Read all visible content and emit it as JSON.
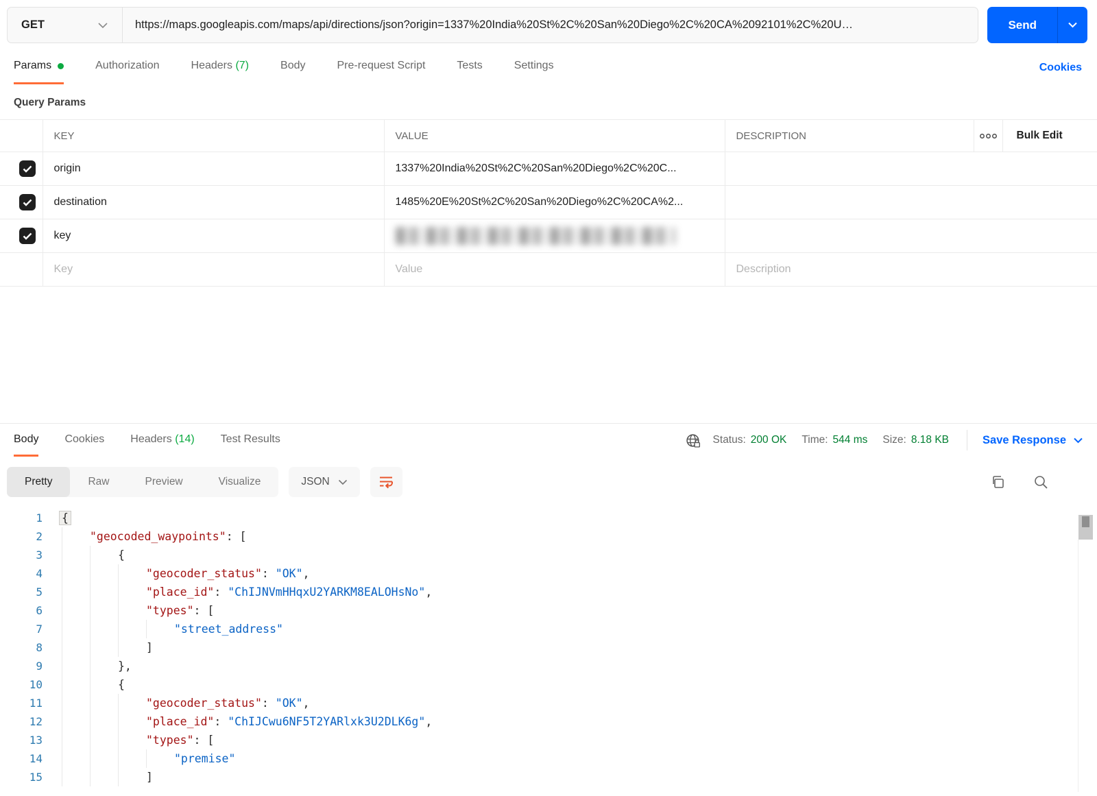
{
  "request": {
    "method": "GET",
    "url": "https://maps.googleapis.com/maps/api/directions/json?origin=1337%20India%20St%2C%20San%20Diego%2C%20CA%2092101%2C%20U…",
    "send_label": "Send",
    "tabs": {
      "params": {
        "label": "Params"
      },
      "authorization": {
        "label": "Authorization"
      },
      "headers": {
        "label": "Headers",
        "count": "(7)"
      },
      "body": {
        "label": "Body"
      },
      "prerequest": {
        "label": "Pre-request Script"
      },
      "tests": {
        "label": "Tests"
      },
      "settings": {
        "label": "Settings"
      }
    },
    "cookies_link": "Cookies",
    "section_title": "Query Params",
    "table": {
      "col_key": "KEY",
      "col_value": "VALUE",
      "col_description": "DESCRIPTION",
      "bulk_edit": "Bulk Edit",
      "rows": [
        {
          "key": "origin",
          "value": "1337%20India%20St%2C%20San%20Diego%2C%20C...",
          "description": "",
          "checked": true,
          "redacted": false
        },
        {
          "key": "destination",
          "value": "1485%20E%20St%2C%20San%20Diego%2C%20CA%2...",
          "description": "",
          "checked": true,
          "redacted": false
        },
        {
          "key": "key",
          "value": "",
          "description": "",
          "checked": true,
          "redacted": true
        }
      ],
      "placeholders": {
        "key": "Key",
        "value": "Value",
        "description": "Description"
      }
    }
  },
  "response": {
    "tabs": {
      "body": {
        "label": "Body"
      },
      "cookies": {
        "label": "Cookies"
      },
      "headers": {
        "label": "Headers",
        "count": "(14)"
      },
      "test_results": {
        "label": "Test Results"
      }
    },
    "meta": {
      "status_label": "Status:",
      "status_value": "200 OK",
      "time_label": "Time:",
      "time_value": "544 ms",
      "size_label": "Size:",
      "size_value": "8.18 KB",
      "save_response": "Save Response"
    },
    "view_tabs": {
      "pretty": "Pretty",
      "raw": "Raw",
      "preview": "Preview",
      "visualize": "Visualize"
    },
    "format_select": "JSON",
    "code_lines": [
      {
        "n": 1,
        "i": 0,
        "s": [
          [
            "hb",
            "{"
          ]
        ]
      },
      {
        "n": 2,
        "i": 1,
        "s": [
          [
            "k",
            "\"geocoded_waypoints\""
          ],
          [
            "p",
            ": ["
          ]
        ]
      },
      {
        "n": 3,
        "i": 2,
        "s": [
          [
            "p",
            "{"
          ]
        ]
      },
      {
        "n": 4,
        "i": 3,
        "s": [
          [
            "k",
            "\"geocoder_status\""
          ],
          [
            "p",
            ": "
          ],
          [
            "s",
            "\"OK\""
          ],
          [
            "p",
            ","
          ]
        ]
      },
      {
        "n": 5,
        "i": 3,
        "s": [
          [
            "k",
            "\"place_id\""
          ],
          [
            "p",
            ": "
          ],
          [
            "s",
            "\"ChIJNVmHHqxU2YARKM8EALOHsNo\""
          ],
          [
            "p",
            ","
          ]
        ]
      },
      {
        "n": 6,
        "i": 3,
        "s": [
          [
            "k",
            "\"types\""
          ],
          [
            "p",
            ": ["
          ]
        ]
      },
      {
        "n": 7,
        "i": 4,
        "s": [
          [
            "s",
            "\"street_address\""
          ]
        ]
      },
      {
        "n": 8,
        "i": 3,
        "s": [
          [
            "p",
            "]"
          ]
        ]
      },
      {
        "n": 9,
        "i": 2,
        "s": [
          [
            "p",
            "},"
          ]
        ]
      },
      {
        "n": 10,
        "i": 2,
        "s": [
          [
            "p",
            "{"
          ]
        ]
      },
      {
        "n": 11,
        "i": 3,
        "s": [
          [
            "k",
            "\"geocoder_status\""
          ],
          [
            "p",
            ": "
          ],
          [
            "s",
            "\"OK\""
          ],
          [
            "p",
            ","
          ]
        ]
      },
      {
        "n": 12,
        "i": 3,
        "s": [
          [
            "k",
            "\"place_id\""
          ],
          [
            "p",
            ": "
          ],
          [
            "s",
            "\"ChIJCwu6NF5T2YARlxk3U2DLK6g\""
          ],
          [
            "p",
            ","
          ]
        ]
      },
      {
        "n": 13,
        "i": 3,
        "s": [
          [
            "k",
            "\"types\""
          ],
          [
            "p",
            ": ["
          ]
        ]
      },
      {
        "n": 14,
        "i": 4,
        "s": [
          [
            "s",
            "\"premise\""
          ]
        ]
      },
      {
        "n": 15,
        "i": 3,
        "s": [
          [
            "p",
            "]"
          ]
        ]
      }
    ]
  },
  "colors": {
    "accent_orange": "#ff6c37",
    "primary_blue": "#0265ff",
    "success_green": "#0caa41",
    "status_green": "#007f31",
    "code_key": "#a31515",
    "code_string": "#0b63c5",
    "line_number": "#2e7bb0"
  }
}
